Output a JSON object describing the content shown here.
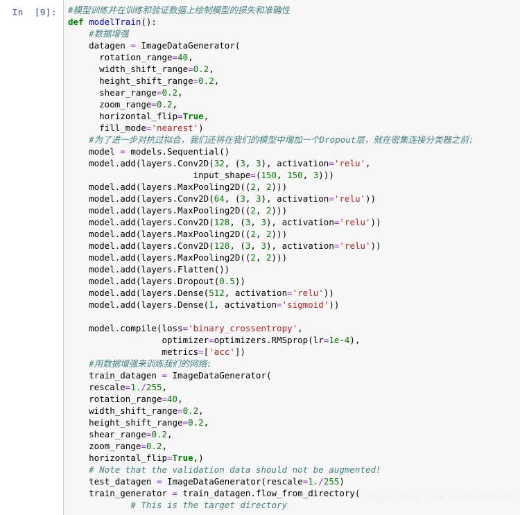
{
  "notebook": {
    "prompt_label": "In  [9]:",
    "execution_count": 9,
    "cell_type": "code",
    "language": "python",
    "watermark": "https://blog.csdn.net/DefiniteMr",
    "colors": {
      "cell_background": "#f7f7f7",
      "page_background": "#ffffff",
      "prompt_text": "#303F9F",
      "cell_border": "#cfcfcf",
      "comment": "#408080",
      "keyword": "#008000",
      "function_name": "#0000FF",
      "string": "#BA2121",
      "number": "#008000",
      "operator": "#AA22FF",
      "watermark": "#f0f0f0"
    }
  },
  "code_lines": [
    {
      "indent": 0,
      "tokens": [
        {
          "t": "#模型训练并在训练和验证数据上绘制模型的损失和准确性",
          "c": "comment"
        }
      ]
    },
    {
      "indent": 0,
      "tokens": [
        {
          "t": "def",
          "c": "keyword"
        },
        {
          "t": " ",
          "c": "plain"
        },
        {
          "t": "modelTrain",
          "c": "func"
        },
        {
          "t": "():",
          "c": "plain"
        }
      ]
    },
    {
      "indent": 1,
      "tokens": [
        {
          "t": "#数据增强",
          "c": "comment"
        }
      ]
    },
    {
      "indent": 1,
      "tokens": [
        {
          "t": "datagen ",
          "c": "plain"
        },
        {
          "t": "=",
          "c": "operator"
        },
        {
          "t": " ImageDataGenerator(",
          "c": "plain"
        }
      ]
    },
    {
      "indent": 1,
      "extra": 2,
      "tokens": [
        {
          "t": "rotation_range",
          "c": "plain"
        },
        {
          "t": "=",
          "c": "operator"
        },
        {
          "t": "40",
          "c": "number"
        },
        {
          "t": ",",
          "c": "plain"
        }
      ]
    },
    {
      "indent": 1,
      "extra": 2,
      "tokens": [
        {
          "t": "width_shift_range",
          "c": "plain"
        },
        {
          "t": "=",
          "c": "operator"
        },
        {
          "t": "0.2",
          "c": "number"
        },
        {
          "t": ",",
          "c": "plain"
        }
      ]
    },
    {
      "indent": 1,
      "extra": 2,
      "tokens": [
        {
          "t": "height_shift_range",
          "c": "plain"
        },
        {
          "t": "=",
          "c": "operator"
        },
        {
          "t": "0.2",
          "c": "number"
        },
        {
          "t": ",",
          "c": "plain"
        }
      ]
    },
    {
      "indent": 1,
      "extra": 2,
      "tokens": [
        {
          "t": "shear_range",
          "c": "plain"
        },
        {
          "t": "=",
          "c": "operator"
        },
        {
          "t": "0.2",
          "c": "number"
        },
        {
          "t": ",",
          "c": "plain"
        }
      ]
    },
    {
      "indent": 1,
      "extra": 2,
      "tokens": [
        {
          "t": "zoom_range",
          "c": "plain"
        },
        {
          "t": "=",
          "c": "operator"
        },
        {
          "t": "0.2",
          "c": "number"
        },
        {
          "t": ",",
          "c": "plain"
        }
      ]
    },
    {
      "indent": 1,
      "extra": 2,
      "tokens": [
        {
          "t": "horizontal_flip",
          "c": "plain"
        },
        {
          "t": "=",
          "c": "operator"
        },
        {
          "t": "True",
          "c": "builtin"
        },
        {
          "t": ",",
          "c": "plain"
        }
      ]
    },
    {
      "indent": 1,
      "extra": 2,
      "tokens": [
        {
          "t": "fill_mode",
          "c": "plain"
        },
        {
          "t": "=",
          "c": "operator"
        },
        {
          "t": "'nearest'",
          "c": "string"
        },
        {
          "t": ")",
          "c": "plain"
        }
      ]
    },
    {
      "indent": 1,
      "tokens": [
        {
          "t": "#为了进一步对抗过拟合，我们还将在我们的模型中增加一个Dropout层，就在密集连接分类器之前:",
          "c": "comment"
        }
      ]
    },
    {
      "indent": 1,
      "tokens": [
        {
          "t": "model ",
          "c": "plain"
        },
        {
          "t": "=",
          "c": "operator"
        },
        {
          "t": " models.Sequential()",
          "c": "plain"
        }
      ]
    },
    {
      "indent": 1,
      "tokens": [
        {
          "t": "model.add(layers.Conv2D(",
          "c": "plain"
        },
        {
          "t": "32",
          "c": "number"
        },
        {
          "t": ", (",
          "c": "plain"
        },
        {
          "t": "3",
          "c": "number"
        },
        {
          "t": ", ",
          "c": "plain"
        },
        {
          "t": "3",
          "c": "number"
        },
        {
          "t": "), activation",
          "c": "plain"
        },
        {
          "t": "=",
          "c": "operator"
        },
        {
          "t": "'relu'",
          "c": "string"
        },
        {
          "t": ",",
          "c": "plain"
        }
      ]
    },
    {
      "indent": 1,
      "extra": 20,
      "tokens": [
        {
          "t": "input_shape",
          "c": "plain"
        },
        {
          "t": "=",
          "c": "operator"
        },
        {
          "t": "(",
          "c": "plain"
        },
        {
          "t": "150",
          "c": "number"
        },
        {
          "t": ", ",
          "c": "plain"
        },
        {
          "t": "150",
          "c": "number"
        },
        {
          "t": ", ",
          "c": "plain"
        },
        {
          "t": "3",
          "c": "number"
        },
        {
          "t": ")))",
          "c": "plain"
        }
      ]
    },
    {
      "indent": 1,
      "tokens": [
        {
          "t": "model.add(layers.MaxPooling2D((",
          "c": "plain"
        },
        {
          "t": "2",
          "c": "number"
        },
        {
          "t": ", ",
          "c": "plain"
        },
        {
          "t": "2",
          "c": "number"
        },
        {
          "t": ")))",
          "c": "plain"
        }
      ]
    },
    {
      "indent": 1,
      "tokens": [
        {
          "t": "model.add(layers.Conv2D(",
          "c": "plain"
        },
        {
          "t": "64",
          "c": "number"
        },
        {
          "t": ", (",
          "c": "plain"
        },
        {
          "t": "3",
          "c": "number"
        },
        {
          "t": ", ",
          "c": "plain"
        },
        {
          "t": "3",
          "c": "number"
        },
        {
          "t": "), activation",
          "c": "plain"
        },
        {
          "t": "=",
          "c": "operator"
        },
        {
          "t": "'relu'",
          "c": "string"
        },
        {
          "t": "))",
          "c": "plain"
        }
      ]
    },
    {
      "indent": 1,
      "tokens": [
        {
          "t": "model.add(layers.MaxPooling2D((",
          "c": "plain"
        },
        {
          "t": "2",
          "c": "number"
        },
        {
          "t": ", ",
          "c": "plain"
        },
        {
          "t": "2",
          "c": "number"
        },
        {
          "t": ")))",
          "c": "plain"
        }
      ]
    },
    {
      "indent": 1,
      "tokens": [
        {
          "t": "model.add(layers.Conv2D(",
          "c": "plain"
        },
        {
          "t": "128",
          "c": "number"
        },
        {
          "t": ", (",
          "c": "plain"
        },
        {
          "t": "3",
          "c": "number"
        },
        {
          "t": ", ",
          "c": "plain"
        },
        {
          "t": "3",
          "c": "number"
        },
        {
          "t": "), activation",
          "c": "plain"
        },
        {
          "t": "=",
          "c": "operator"
        },
        {
          "t": "'relu'",
          "c": "string"
        },
        {
          "t": "))",
          "c": "plain"
        }
      ]
    },
    {
      "indent": 1,
      "tokens": [
        {
          "t": "model.add(layers.MaxPooling2D((",
          "c": "plain"
        },
        {
          "t": "2",
          "c": "number"
        },
        {
          "t": ", ",
          "c": "plain"
        },
        {
          "t": "2",
          "c": "number"
        },
        {
          "t": ")))",
          "c": "plain"
        }
      ]
    },
    {
      "indent": 1,
      "tokens": [
        {
          "t": "model.add(layers.Conv2D(",
          "c": "plain"
        },
        {
          "t": "128",
          "c": "number"
        },
        {
          "t": ", (",
          "c": "plain"
        },
        {
          "t": "3",
          "c": "number"
        },
        {
          "t": ", ",
          "c": "plain"
        },
        {
          "t": "3",
          "c": "number"
        },
        {
          "t": "), activation",
          "c": "plain"
        },
        {
          "t": "=",
          "c": "operator"
        },
        {
          "t": "'relu'",
          "c": "string"
        },
        {
          "t": "))",
          "c": "plain"
        }
      ]
    },
    {
      "indent": 1,
      "tokens": [
        {
          "t": "model.add(layers.MaxPooling2D((",
          "c": "plain"
        },
        {
          "t": "2",
          "c": "number"
        },
        {
          "t": ", ",
          "c": "plain"
        },
        {
          "t": "2",
          "c": "number"
        },
        {
          "t": ")))",
          "c": "plain"
        }
      ]
    },
    {
      "indent": 1,
      "tokens": [
        {
          "t": "model.add(layers.Flatten())",
          "c": "plain"
        }
      ]
    },
    {
      "indent": 1,
      "tokens": [
        {
          "t": "model.add(layers.Dropout(",
          "c": "plain"
        },
        {
          "t": "0.5",
          "c": "number"
        },
        {
          "t": "))",
          "c": "plain"
        }
      ]
    },
    {
      "indent": 1,
      "tokens": [
        {
          "t": "model.add(layers.Dense(",
          "c": "plain"
        },
        {
          "t": "512",
          "c": "number"
        },
        {
          "t": ", activation",
          "c": "plain"
        },
        {
          "t": "=",
          "c": "operator"
        },
        {
          "t": "'relu'",
          "c": "string"
        },
        {
          "t": "))",
          "c": "plain"
        }
      ]
    },
    {
      "indent": 1,
      "tokens": [
        {
          "t": "model.add(layers.Dense(",
          "c": "plain"
        },
        {
          "t": "1",
          "c": "number"
        },
        {
          "t": ", activation",
          "c": "plain"
        },
        {
          "t": "=",
          "c": "operator"
        },
        {
          "t": "'sigmoid'",
          "c": "string"
        },
        {
          "t": "))",
          "c": "plain"
        }
      ]
    },
    {
      "indent": 0,
      "tokens": []
    },
    {
      "indent": 1,
      "tokens": [
        {
          "t": "model.compile(loss",
          "c": "plain"
        },
        {
          "t": "=",
          "c": "operator"
        },
        {
          "t": "'binary_crossentropy'",
          "c": "string"
        },
        {
          "t": ",",
          "c": "plain"
        }
      ]
    },
    {
      "indent": 1,
      "extra": 14,
      "tokens": [
        {
          "t": "optimizer",
          "c": "plain"
        },
        {
          "t": "=",
          "c": "operator"
        },
        {
          "t": "optimizers.RMSprop(lr",
          "c": "plain"
        },
        {
          "t": "=",
          "c": "operator"
        },
        {
          "t": "1e-4",
          "c": "number"
        },
        {
          "t": "),",
          "c": "plain"
        }
      ]
    },
    {
      "indent": 1,
      "extra": 14,
      "tokens": [
        {
          "t": "metrics",
          "c": "plain"
        },
        {
          "t": "=",
          "c": "operator"
        },
        {
          "t": "[",
          "c": "plain"
        },
        {
          "t": "'acc'",
          "c": "string"
        },
        {
          "t": "])",
          "c": "plain"
        }
      ]
    },
    {
      "indent": 1,
      "tokens": [
        {
          "t": "#用数据增强来训练我们的网络:",
          "c": "comment"
        }
      ]
    },
    {
      "indent": 1,
      "tokens": [
        {
          "t": "train_datagen ",
          "c": "plain"
        },
        {
          "t": "=",
          "c": "operator"
        },
        {
          "t": " ImageDataGenerator(",
          "c": "plain"
        }
      ]
    },
    {
      "indent": 1,
      "tokens": [
        {
          "t": "rescale",
          "c": "plain"
        },
        {
          "t": "=",
          "c": "operator"
        },
        {
          "t": "1.",
          "c": "number"
        },
        {
          "t": "/",
          "c": "operator"
        },
        {
          "t": "255",
          "c": "number"
        },
        {
          "t": ",",
          "c": "plain"
        }
      ]
    },
    {
      "indent": 1,
      "tokens": [
        {
          "t": "rotation_range",
          "c": "plain"
        },
        {
          "t": "=",
          "c": "operator"
        },
        {
          "t": "40",
          "c": "number"
        },
        {
          "t": ",",
          "c": "plain"
        }
      ]
    },
    {
      "indent": 1,
      "tokens": [
        {
          "t": "width_shift_range",
          "c": "plain"
        },
        {
          "t": "=",
          "c": "operator"
        },
        {
          "t": "0.2",
          "c": "number"
        },
        {
          "t": ",",
          "c": "plain"
        }
      ]
    },
    {
      "indent": 1,
      "tokens": [
        {
          "t": "height_shift_range",
          "c": "plain"
        },
        {
          "t": "=",
          "c": "operator"
        },
        {
          "t": "0.2",
          "c": "number"
        },
        {
          "t": ",",
          "c": "plain"
        }
      ]
    },
    {
      "indent": 1,
      "tokens": [
        {
          "t": "shear_range",
          "c": "plain"
        },
        {
          "t": "=",
          "c": "operator"
        },
        {
          "t": "0.2",
          "c": "number"
        },
        {
          "t": ",",
          "c": "plain"
        }
      ]
    },
    {
      "indent": 1,
      "tokens": [
        {
          "t": "zoom_range",
          "c": "plain"
        },
        {
          "t": "=",
          "c": "operator"
        },
        {
          "t": "0.2",
          "c": "number"
        },
        {
          "t": ",",
          "c": "plain"
        }
      ]
    },
    {
      "indent": 1,
      "tokens": [
        {
          "t": "horizontal_flip",
          "c": "plain"
        },
        {
          "t": "=",
          "c": "operator"
        },
        {
          "t": "True",
          "c": "builtin"
        },
        {
          "t": ",)",
          "c": "plain"
        }
      ]
    },
    {
      "indent": 1,
      "tokens": [
        {
          "t": "# Note that the validation data should not be augmented!",
          "c": "comment"
        }
      ]
    },
    {
      "indent": 1,
      "tokens": [
        {
          "t": "test_datagen ",
          "c": "plain"
        },
        {
          "t": "=",
          "c": "operator"
        },
        {
          "t": " ImageDataGenerator(rescale",
          "c": "plain"
        },
        {
          "t": "=",
          "c": "operator"
        },
        {
          "t": "1.",
          "c": "number"
        },
        {
          "t": "/",
          "c": "operator"
        },
        {
          "t": "255",
          "c": "number"
        },
        {
          "t": ")",
          "c": "plain"
        }
      ]
    },
    {
      "indent": 1,
      "tokens": [
        {
          "t": "train_generator ",
          "c": "plain"
        },
        {
          "t": "=",
          "c": "operator"
        },
        {
          "t": " train_datagen.flow_from_directory(",
          "c": "plain"
        }
      ]
    },
    {
      "indent": 1,
      "extra": 8,
      "tokens": [
        {
          "t": "# This is the target directory",
          "c": "comment"
        }
      ]
    }
  ]
}
